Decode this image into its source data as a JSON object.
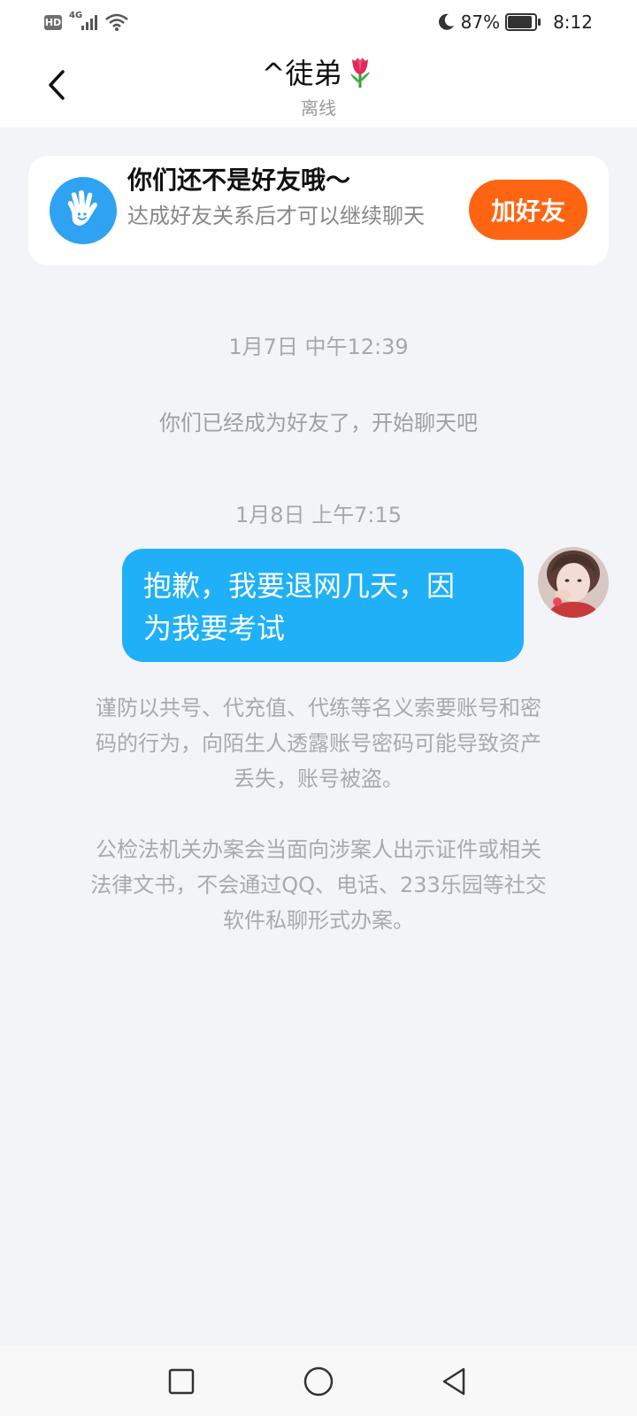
{
  "status_bar": {
    "hd_label": "HD",
    "network_type": "4G",
    "battery_percent": "87%",
    "time": "8:12",
    "icons": [
      "hd-icon",
      "signal-icon",
      "wifi-icon",
      "moon-icon",
      "battery-icon"
    ]
  },
  "header": {
    "title": "^徒弟",
    "title_emoji_icon": "tulip-icon",
    "status": "离线"
  },
  "friend_card": {
    "title": "你们还不是好友哦～",
    "description": "达成好友关系后才可以继续聊天",
    "button_label": "加好友",
    "icon": "waving-hand-icon",
    "colors": {
      "icon_bg": "#2fa3f2",
      "button_bg": "#fd6512"
    }
  },
  "messages": {
    "timestamp_1": "1月7日 中午12:39",
    "system_friend_added": "你们已经成为好友了，开始聊天吧",
    "timestamp_2": "1月8日 上午7:15",
    "outgoing_text_line1": "抱歉，我要退网几天，因",
    "outgoing_text_line2": "为我要考试",
    "bubble_color": "#1fb0f8"
  },
  "notices": {
    "warning_1_line1": "谨防以共号、代充值、代练等名义索要账号和密",
    "warning_1_line2": "码的行为，向陌生人透露账号密码可能导致资产",
    "warning_1_line3": "丢失，账号被盗。",
    "warning_2_line1": "公检法机关办案会当面向涉案人出示证件或相关",
    "warning_2_line2": "法律文书，不会通过QQ、电话、233乐园等社交",
    "warning_2_line3": "软件私聊形式办案。"
  },
  "nav_bar": {
    "icons": [
      "recents-square-icon",
      "home-circle-icon",
      "back-triangle-icon"
    ]
  }
}
